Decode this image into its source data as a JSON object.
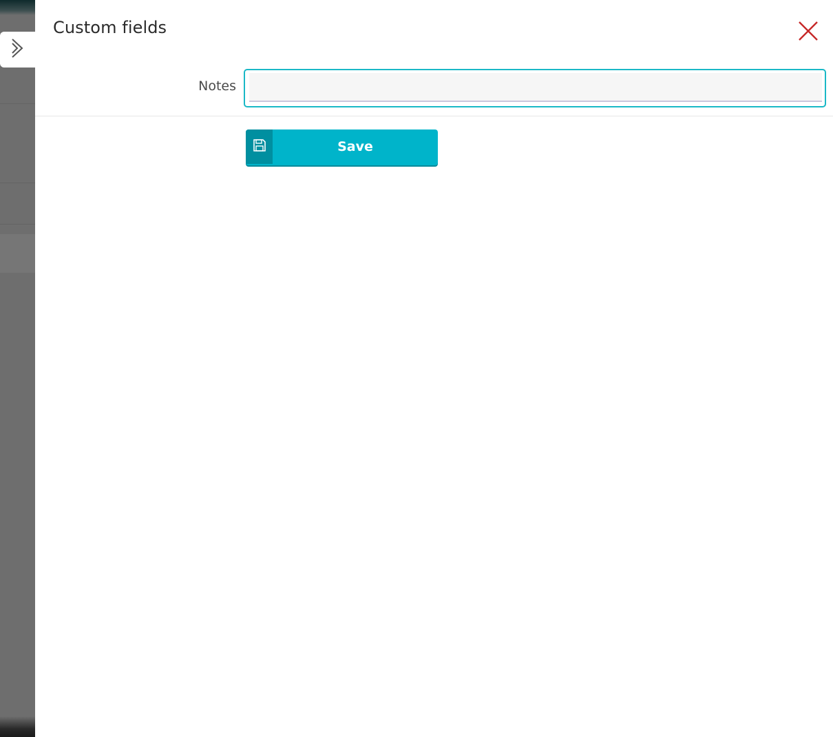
{
  "panel": {
    "title": "Custom fields"
  },
  "form": {
    "notes_label": "Notes",
    "notes_value": "",
    "notes_placeholder": ""
  },
  "actions": {
    "save_label": "Save"
  },
  "icons": {
    "expand": "chevron-right-icon",
    "close": "close-icon",
    "save": "floppy-disk-icon"
  },
  "colors": {
    "accent": "#00b4ca",
    "accent_dark": "#008fa0",
    "close": "#c62828",
    "focus_border": "#19b8c6"
  }
}
